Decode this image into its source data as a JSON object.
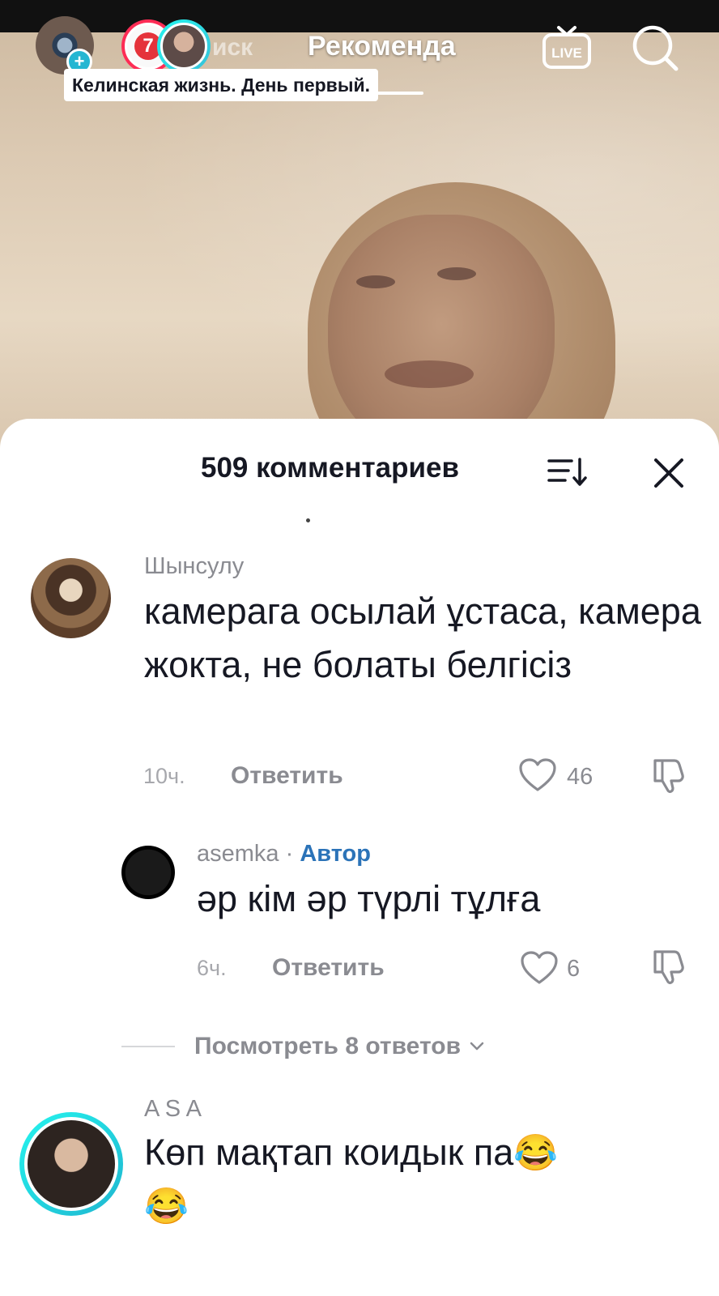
{
  "video": {
    "caption": "Келинская жизнь. День первый."
  },
  "top_nav": {
    "story_badge_number": "7",
    "faded_tab_label": "иск",
    "active_tab_label": "Рекоменда",
    "live_label": "LIVE"
  },
  "comments_sheet": {
    "title": "509 комментариев",
    "comments": [
      {
        "username": "Шынсулу",
        "text": "камерага осылай ұстаса, камера жокта, не болаты белгісіз",
        "time": "10ч.",
        "reply_label": "Ответить",
        "likes": "46"
      },
      {
        "username": "asemka",
        "separator": " · ",
        "author_badge": "Автор",
        "text": "әр кім әр түрлі тұлға",
        "time": "6ч.",
        "reply_label": "Ответить",
        "likes": "6"
      },
      {
        "username": "A S A",
        "text": "Көп мақтап коидык па",
        "emoji": "😂"
      }
    ],
    "view_replies_label": "Посмотреть 8 ответов"
  },
  "colors": {
    "accent_red": "#fe2c55",
    "teal": "#25b6d2",
    "author_blue": "#2b73b8",
    "muted_text": "#8a8b91"
  },
  "icons": {
    "sort": "sort-icon",
    "close": "close-icon",
    "like": "heart-icon",
    "dislike": "thumbs-down-icon",
    "live": "live-tv-icon",
    "search": "search-icon",
    "chevron": "chevron-down-icon"
  }
}
